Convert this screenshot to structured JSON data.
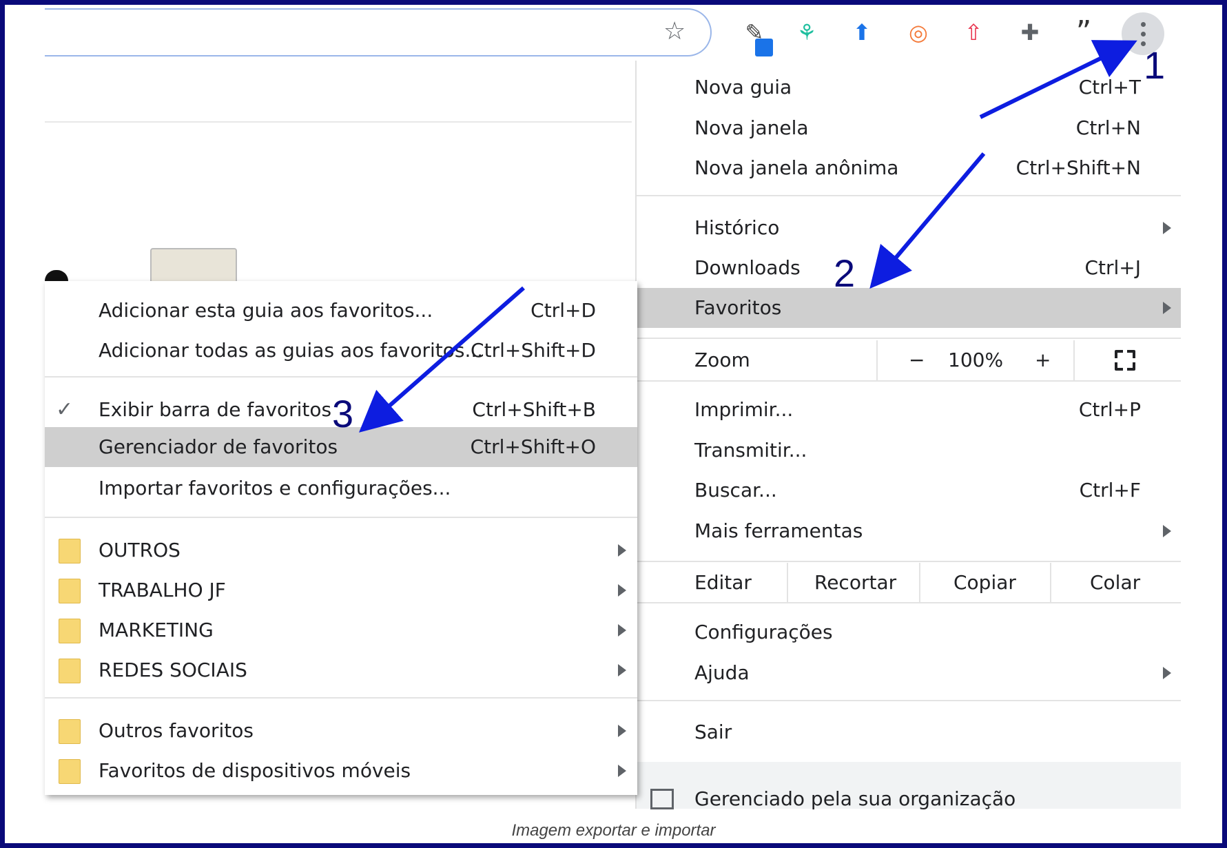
{
  "toolbar": {
    "bookmark_star": "star-icon",
    "extensions": [
      "eyedropper-icon",
      "runner-icon",
      "upload-icon",
      "target-icon",
      "upload-box-icon",
      "puzzle-icon",
      "quote-icon"
    ],
    "ext_glyphs": [
      "✎",
      "⚘",
      "⬆",
      "◎",
      "⇧",
      "✚",
      "”"
    ],
    "menu_button": "more-vert-icon"
  },
  "main_menu": {
    "new_tab": {
      "label": "Nova guia",
      "shortcut": "Ctrl+T"
    },
    "new_window": {
      "label": "Nova janela",
      "shortcut": "Ctrl+N"
    },
    "incognito": {
      "label": "Nova janela anônima",
      "shortcut": "Ctrl+Shift+N"
    },
    "history": {
      "label": "Histórico"
    },
    "downloads": {
      "label": "Downloads",
      "shortcut": "Ctrl+J"
    },
    "bookmarks": {
      "label": "Favoritos"
    },
    "zoom": {
      "label": "Zoom",
      "minus": "−",
      "value": "100%",
      "plus": "+"
    },
    "print": {
      "label": "Imprimir...",
      "shortcut": "Ctrl+P"
    },
    "cast": {
      "label": "Transmitir..."
    },
    "find": {
      "label": "Buscar...",
      "shortcut": "Ctrl+F"
    },
    "more_tools": {
      "label": "Mais ferramentas"
    },
    "edit": {
      "label": "Editar",
      "cut": "Recortar",
      "copy": "Copiar",
      "paste": "Colar"
    },
    "settings": {
      "label": "Configurações"
    },
    "help": {
      "label": "Ajuda"
    },
    "exit": {
      "label": "Sair"
    },
    "managed": {
      "label": "Gerenciado pela sua organização"
    }
  },
  "bookmarks_menu": {
    "add_tab": {
      "label": "Adicionar esta guia aos favoritos...",
      "shortcut": "Ctrl+D"
    },
    "add_all": {
      "label": "Adicionar todas as guias aos favoritos...",
      "shortcut": "Ctrl+Shift+D"
    },
    "show_bar": {
      "label": "Exibir barra de favoritos",
      "shortcut": "Ctrl+Shift+B",
      "check": "✓"
    },
    "manager": {
      "label": "Gerenciador de favoritos",
      "shortcut": "Ctrl+Shift+O"
    },
    "import": {
      "label": "Importar favoritos e configurações..."
    },
    "folders": [
      "OUTROS",
      "TRABALHO JF",
      "MARKETING",
      "REDES SOCIAIS"
    ],
    "other_bookmarks": "Outros favoritos",
    "mobile_bookmarks": "Favoritos de dispositivos móveis"
  },
  "annotations": {
    "step1": "1",
    "step2": "2",
    "step3": "3",
    "color": "#0d1de0"
  },
  "caption": "Imagem exportar e importar"
}
